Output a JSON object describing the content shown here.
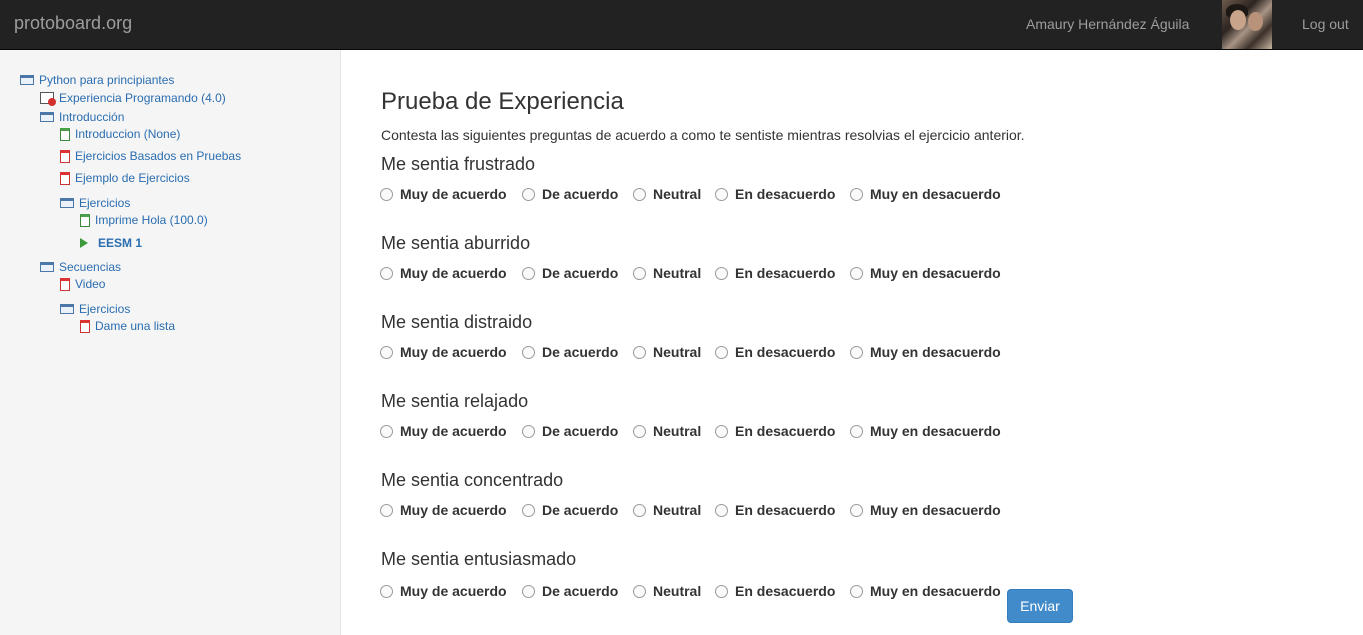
{
  "navbar": {
    "brand": "protoboard.org",
    "user_name": "Amaury Hernández Águila",
    "logout": "Log out"
  },
  "sidebar": {
    "items": [
      {
        "label": "Python para principiantes",
        "icon": "folder-icon"
      },
      {
        "label": "Experiencia Programando (4.0)",
        "icon": "badge-icon"
      },
      {
        "label": "Introducción",
        "icon": "folder-icon"
      },
      {
        "label": "Introduccion (None)",
        "icon": "document-green-icon"
      },
      {
        "label": "Ejercicios Basados en Pruebas",
        "icon": "document-red-icon"
      },
      {
        "label": "Ejemplo de Ejercicios",
        "icon": "document-red-icon"
      },
      {
        "label": "Ejercicios",
        "icon": "folder-icon"
      },
      {
        "label": "Imprime Hola (100.0)",
        "icon": "document-green-icon"
      },
      {
        "label": "EESM 1",
        "icon": "arrow-right-icon"
      },
      {
        "label": "Secuencias",
        "icon": "folder-icon"
      },
      {
        "label": "Video",
        "icon": "document-red-icon"
      },
      {
        "label": "Ejercicios",
        "icon": "folder-icon"
      },
      {
        "label": "Dame una lista",
        "icon": "document-red-icon"
      }
    ]
  },
  "main": {
    "title": "Prueba de Experiencia",
    "intro": "Contesta las siguientes preguntas de acuerdo a como te sentiste mientras resolvias el ejercicio anterior.",
    "options": [
      "Muy de acuerdo",
      "De acuerdo",
      "Neutral",
      "En desacuerdo",
      "Muy en desacuerdo"
    ],
    "questions": [
      {
        "title": "Me sentia frustrado"
      },
      {
        "title": "Me sentia aburrido"
      },
      {
        "title": "Me sentia distraido"
      },
      {
        "title": "Me sentia relajado"
      },
      {
        "title": "Me sentia concentrado"
      },
      {
        "title": "Me sentia entusiasmado"
      }
    ],
    "submit_label": "Enviar"
  }
}
